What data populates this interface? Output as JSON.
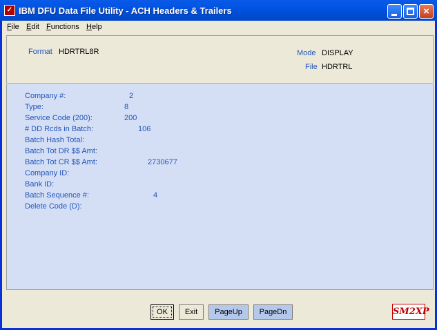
{
  "window": {
    "title": "IBM DFU Data File Utility - ACH Headers & Trailers",
    "controls": {
      "minimize": "minimize",
      "maximize": "maximize",
      "close": "×"
    }
  },
  "menu": [
    {
      "accel": "F",
      "rest": "ile"
    },
    {
      "accel": "E",
      "rest": "dit"
    },
    {
      "accel": "F",
      "rest": "unctions"
    },
    {
      "accel": "H",
      "rest": "elp"
    }
  ],
  "header": {
    "format_label": "Format",
    "format_value": "HDRTRL8R",
    "mode_label": "Mode",
    "mode_value": "DISPLAY",
    "file_label": "File",
    "file_value": "HDRTRL"
  },
  "fields": [
    {
      "label": "Company #:",
      "value": "2"
    },
    {
      "label": "Type:",
      "value": "8"
    },
    {
      "label": "Service Code (200):",
      "value": "200"
    },
    {
      "label": "# DD Rcds in Batch:",
      "value": "106"
    },
    {
      "label": "Batch Hash Total:",
      "value": ""
    },
    {
      "label": "Batch Tot DR $$ Amt:",
      "value": ""
    },
    {
      "label": "Batch Tot CR $$ Amt:",
      "value": "2730677"
    },
    {
      "label": "Company ID:",
      "value": ""
    },
    {
      "label": "Bank ID:",
      "value": ""
    },
    {
      "label": "Batch Sequence #:",
      "value": "4"
    },
    {
      "label": "Delete Code (D):",
      "value": ""
    }
  ],
  "buttons": {
    "ok": "OK",
    "exit": "Exit",
    "pageup": "PageUp",
    "pagedn": "PageDn"
  },
  "logo": "SM2XP"
}
